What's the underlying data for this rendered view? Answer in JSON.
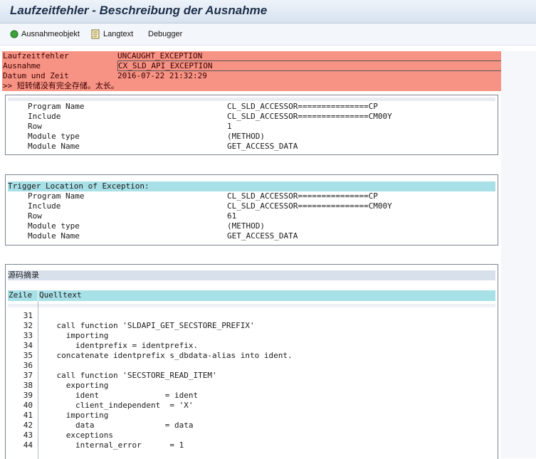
{
  "window": {
    "title": "Laufzeitfehler - Beschreibung der Ausnahme"
  },
  "toolbar": {
    "items": [
      {
        "label": "Ausnahmeobjekt",
        "icon": "green-circle-icon"
      },
      {
        "label": "Langtext",
        "icon": "document-icon"
      },
      {
        "label": "Debugger",
        "icon": ""
      }
    ]
  },
  "error": {
    "rows": [
      {
        "key": "Laufzeitfehler",
        "value": "UNCAUGHT_EXCEPTION"
      },
      {
        "key": "Ausnahme",
        "value": "CX_SLD_API_EXCEPTION"
      },
      {
        "key": "Datum und Zeit",
        "value": "2016-07-22 21:32:29"
      }
    ],
    "message": ">> 短转储没有完全存储。太长。"
  },
  "location1": {
    "rows": [
      {
        "key": "Program Name",
        "value": "CL_SLD_ACCESSOR===============CP"
      },
      {
        "key": "Include",
        "value": "CL_SLD_ACCESSOR===============CM00Y"
      },
      {
        "key": "Row",
        "value": "1"
      },
      {
        "key": "Module type",
        "value": "(METHOD)"
      },
      {
        "key": "Module Name",
        "value": "GET_ACCESS_DATA"
      }
    ]
  },
  "location2": {
    "title": "Trigger Location of Exception:",
    "rows": [
      {
        "key": "Program Name",
        "value": "CL_SLD_ACCESSOR===============CP"
      },
      {
        "key": "Include",
        "value": "CL_SLD_ACCESSOR===============CM00Y"
      },
      {
        "key": "Row",
        "value": "61"
      },
      {
        "key": "Module type",
        "value": "(METHOD)"
      },
      {
        "key": "Module Name",
        "value": "GET_ACCESS_DATA"
      }
    ]
  },
  "source": {
    "title": "源码摘录",
    "col_line": "Zeile",
    "col_text": "Quelltext",
    "lines": [
      {
        "no": "31",
        "code": ""
      },
      {
        "no": "32",
        "code": "    call function 'SLDAPI_GET_SECSTORE_PREFIX'"
      },
      {
        "no": "33",
        "code": "      importing"
      },
      {
        "no": "34",
        "code": "        identprefix = identprefix."
      },
      {
        "no": "35",
        "code": "    concatenate identprefix s_dbdata-alias into ident."
      },
      {
        "no": "36",
        "code": ""
      },
      {
        "no": "37",
        "code": "    call function 'SECSTORE_READ_ITEM'"
      },
      {
        "no": "38",
        "code": "      exporting"
      },
      {
        "no": "39",
        "code": "        ident              = ident"
      },
      {
        "no": "40",
        "code": "        client_independent  = 'X'"
      },
      {
        "no": "41",
        "code": "      importing"
      },
      {
        "no": "42",
        "code": "        data               = data"
      },
      {
        "no": "43",
        "code": "      exceptions"
      },
      {
        "no": "44",
        "code": "        internal_error      = 1"
      }
    ]
  }
}
